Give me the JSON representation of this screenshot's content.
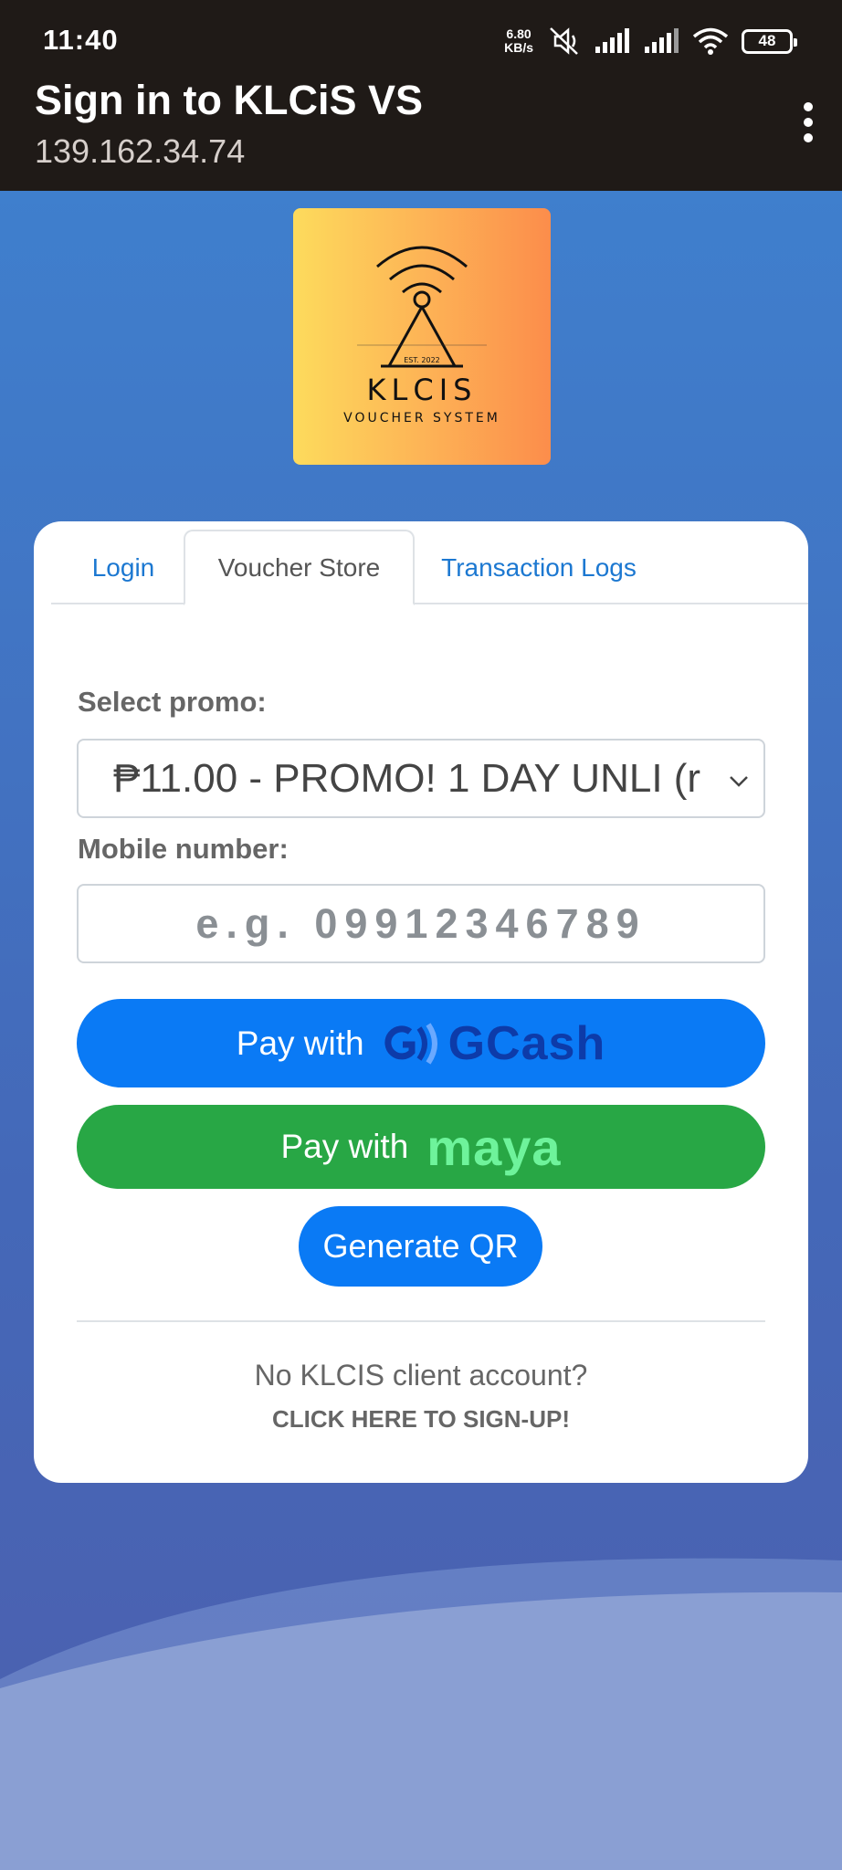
{
  "status_bar": {
    "time": "11:40",
    "speed_value": "6.80",
    "speed_unit": "KB/s",
    "battery": "48"
  },
  "app_bar": {
    "title": "Sign in to KLCiS VS",
    "subtitle": "139.162.34.74"
  },
  "logo": {
    "text_main": "KLCIS",
    "text_sub": "VOUCHER SYSTEM",
    "text_est": "EST. 2022"
  },
  "tabs": [
    {
      "label": "Login",
      "active": false
    },
    {
      "label": "Voucher Store",
      "active": true
    },
    {
      "label": "Transaction Logs",
      "active": false
    }
  ],
  "form": {
    "promo_label": "Select promo:",
    "promo_value": "₱11.00 - PROMO! 1 DAY UNLI (r",
    "mobile_label": "Mobile number:",
    "mobile_placeholder": "e.g. 09912346789"
  },
  "buttons": {
    "gcash_prefix": "Pay with",
    "gcash_brand": "GCash",
    "maya_prefix": "Pay with",
    "maya_brand": "maya",
    "generate_qr": "Generate QR"
  },
  "footer": {
    "no_account": "No KLCIS client account?",
    "signup": "CLICK HERE TO SIGN-UP!"
  },
  "colors": {
    "primary": "#0a7af5",
    "maya_green": "#28a745",
    "tab_link": "#1c78d1"
  }
}
